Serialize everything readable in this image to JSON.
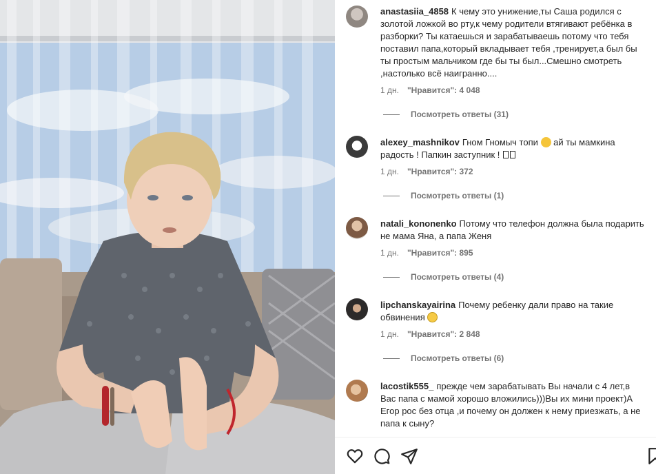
{
  "comments": [
    {
      "username": "anastasiia_4858",
      "text": "К чему это унижение,ты Саша родился с золотой ложкой во рту,к чему родители втягивают ребёнка в разборки? Ты катаешься и зарабатываешь потому что тебя поставил папа,который вкладывает тебя ,тренирует,а был бы ты простым мальчиком где бы ты был...Смешно смотреть ,настолько всё наигранно....",
      "time": "1 дн.",
      "likes": "\"Нравится\": 4 048",
      "replies": "Посмотреть ответы (31)"
    },
    {
      "username": "alexey_mashnikov",
      "text": "Гном Гномыч топи",
      "text_after": " ай ты мамкина радость ! Папкин заступник ! ",
      "time": "1 дн.",
      "likes": "\"Нравится\": 372",
      "replies": "Посмотреть ответы (1)"
    },
    {
      "username": "natali_kononenko",
      "text": "Потому что телефон должна была подарить не мама Яна, а папа Женя",
      "time": "1 дн.",
      "likes": "\"Нравится\": 895",
      "replies": "Посмотреть ответы (4)"
    },
    {
      "username": "lipchanskayairina",
      "text": "Почему ребенку дали право на такие обвинения",
      "time": "1 дн.",
      "likes": "\"Нравится\": 2 848",
      "replies": "Посмотреть ответы (6)"
    },
    {
      "username": "lacostik555_",
      "text": "прежде чем зарабатывать Вы начали с 4 лет,в Вас папа с мамой хорошо вложились)))Вы их мини проект)А Егор рос без отца ,и почему он должен к нему приезжать, а не папа к сыну?"
    }
  ],
  "colors": {
    "text": "#262626",
    "secondary": "#737373"
  },
  "icons": [
    "heart-icon",
    "comment-icon",
    "share-icon",
    "bookmark-icon"
  ]
}
